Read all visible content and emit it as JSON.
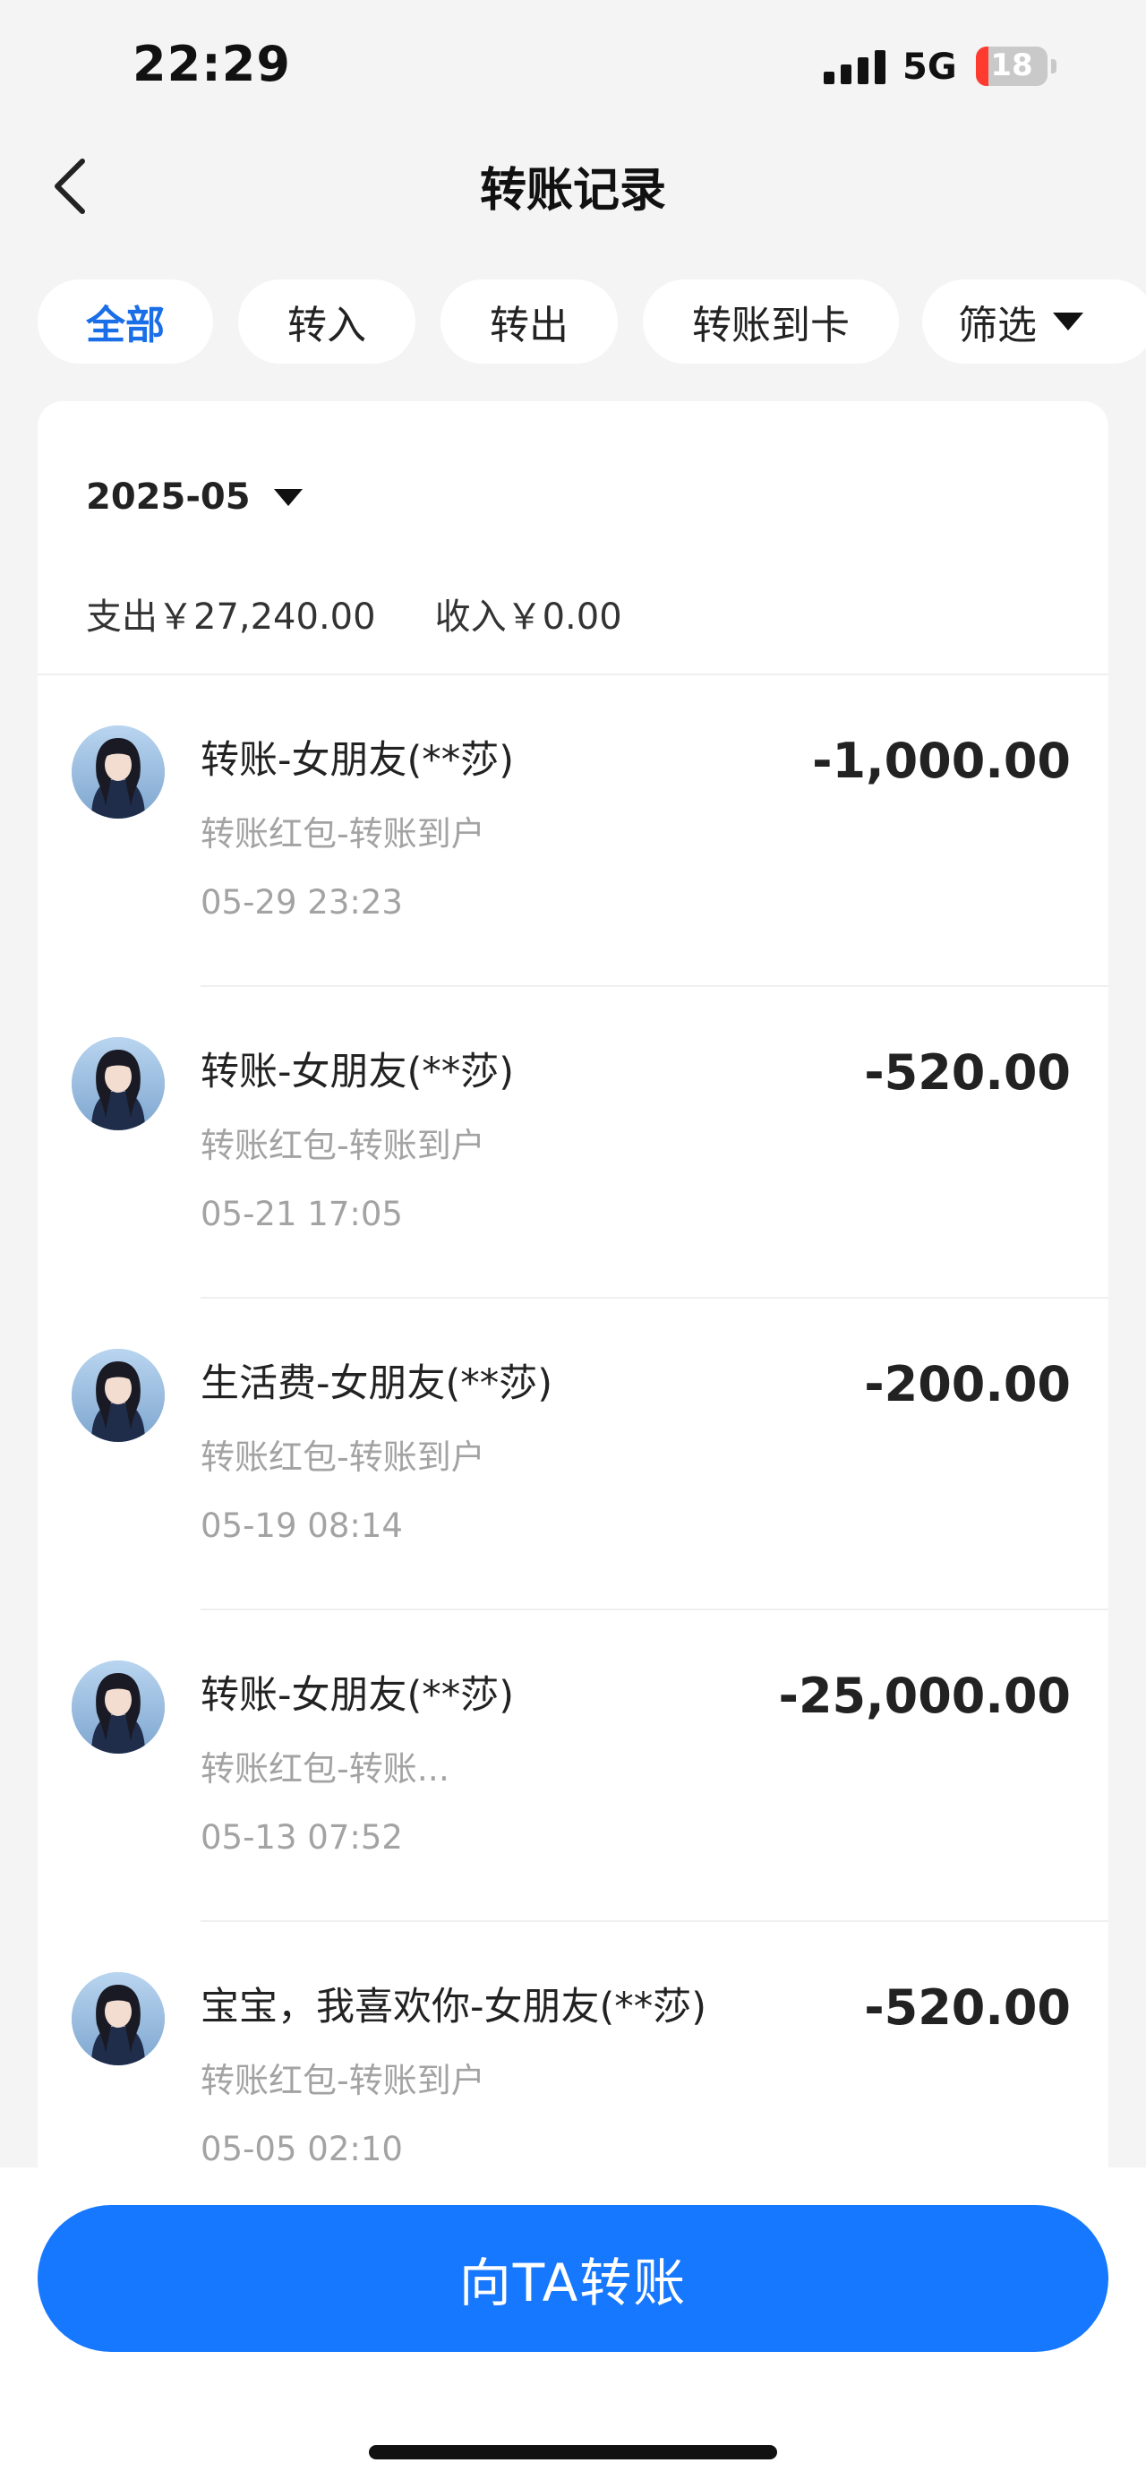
{
  "status_bar": {
    "time": "22:29",
    "network": "5G",
    "battery": "18",
    "battery_level_percent": 18
  },
  "header": {
    "title": "转账记录",
    "back_icon": "chevron-left-icon"
  },
  "tabs": [
    {
      "label": "全部",
      "active": true
    },
    {
      "label": "转入",
      "active": false
    },
    {
      "label": "转出",
      "active": false
    },
    {
      "label": "转账到卡",
      "active": false
    },
    {
      "label": "筛选",
      "active": false,
      "icon": "caret-down-icon"
    }
  ],
  "summary": {
    "month": "2025-05",
    "expense": "支出￥27,240.00",
    "income": "收入￥0.00"
  },
  "transactions": [
    {
      "title": "转账-女朋友(**莎)",
      "subtitle": "转账红包-转账到户",
      "time": "05-29 23:23",
      "amount": "-1,000.00"
    },
    {
      "title": "转账-女朋友(**莎)",
      "subtitle": "转账红包-转账到户",
      "time": "05-21 17:05",
      "amount": "-520.00"
    },
    {
      "title": "生活费-女朋友(**莎)",
      "subtitle": "转账红包-转账到户",
      "time": "05-19 08:14",
      "amount": "-200.00"
    },
    {
      "title": "转账-女朋友(**莎)",
      "subtitle": "转账红包-转账...",
      "time": "05-13 07:52",
      "amount": "-25,000.00"
    },
    {
      "title": "宝宝，我喜欢你-女朋友(**莎)",
      "subtitle": "转账红包-转账到户",
      "time": "05-05 02:10",
      "amount": "-520.00"
    }
  ],
  "cta": {
    "label": "向TA转账"
  },
  "colors": {
    "accent": "#1677ff",
    "active_tab": "#1a6fe8",
    "background": "#f4f4f4",
    "muted_text": "#a3a3a3",
    "battery_low": "#ff3b30"
  }
}
